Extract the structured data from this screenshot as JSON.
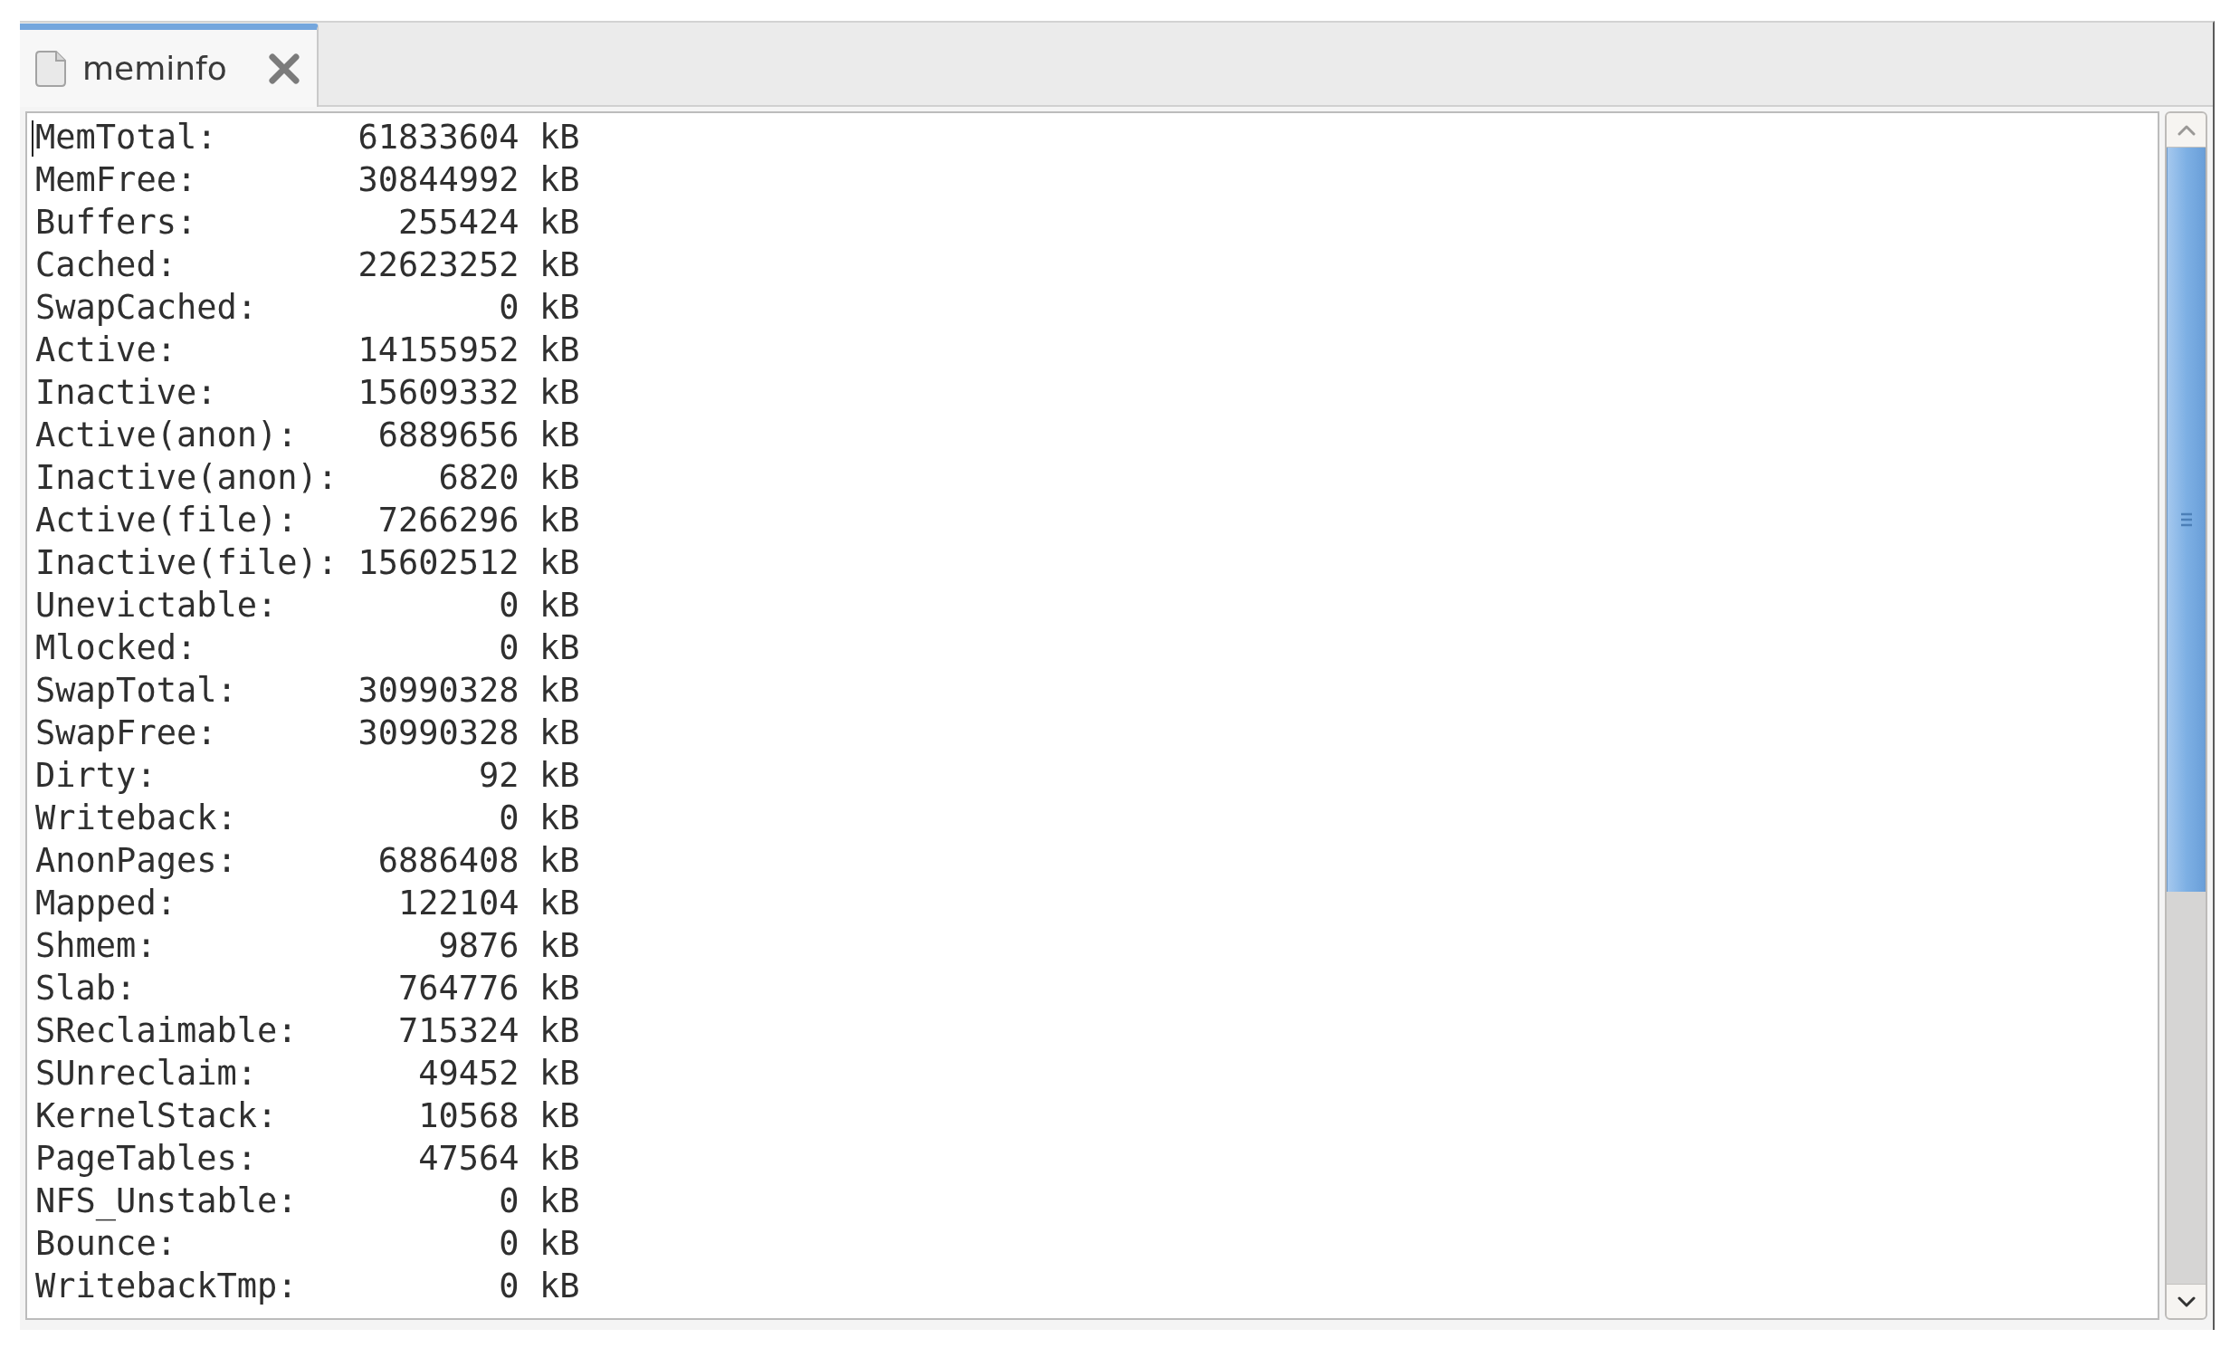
{
  "tabs": [
    {
      "label": "meminfo",
      "selected": true
    }
  ],
  "editor": {
    "cursor": true,
    "lines": [
      {
        "key": "MemTotal:",
        "value": "61833604",
        "unit": "kB"
      },
      {
        "key": "MemFree:",
        "value": "30844992",
        "unit": "kB"
      },
      {
        "key": "Buffers:",
        "value": "255424",
        "unit": "kB"
      },
      {
        "key": "Cached:",
        "value": "22623252",
        "unit": "kB"
      },
      {
        "key": "SwapCached:",
        "value": "0",
        "unit": "kB"
      },
      {
        "key": "Active:",
        "value": "14155952",
        "unit": "kB"
      },
      {
        "key": "Inactive:",
        "value": "15609332",
        "unit": "kB"
      },
      {
        "key": "Active(anon):",
        "value": "6889656",
        "unit": "kB"
      },
      {
        "key": "Inactive(anon):",
        "value": "6820",
        "unit": "kB"
      },
      {
        "key": "Active(file):",
        "value": "7266296",
        "unit": "kB"
      },
      {
        "key": "Inactive(file):",
        "value": "15602512",
        "unit": "kB"
      },
      {
        "key": "Unevictable:",
        "value": "0",
        "unit": "kB"
      },
      {
        "key": "Mlocked:",
        "value": "0",
        "unit": "kB"
      },
      {
        "key": "SwapTotal:",
        "value": "30990328",
        "unit": "kB"
      },
      {
        "key": "SwapFree:",
        "value": "30990328",
        "unit": "kB"
      },
      {
        "key": "Dirty:",
        "value": "92",
        "unit": "kB"
      },
      {
        "key": "Writeback:",
        "value": "0",
        "unit": "kB"
      },
      {
        "key": "AnonPages:",
        "value": "6886408",
        "unit": "kB"
      },
      {
        "key": "Mapped:",
        "value": "122104",
        "unit": "kB"
      },
      {
        "key": "Shmem:",
        "value": "9876",
        "unit": "kB"
      },
      {
        "key": "Slab:",
        "value": "764776",
        "unit": "kB"
      },
      {
        "key": "SReclaimable:",
        "value": "715324",
        "unit": "kB"
      },
      {
        "key": "SUnreclaim:",
        "value": "49452",
        "unit": "kB"
      },
      {
        "key": "KernelStack:",
        "value": "10568",
        "unit": "kB"
      },
      {
        "key": "PageTables:",
        "value": "47564",
        "unit": "kB"
      },
      {
        "key": "NFS_Unstable:",
        "value": "0",
        "unit": "kB"
      },
      {
        "key": "Bounce:",
        "value": "0",
        "unit": "kB"
      },
      {
        "key": "WritebackTmp:",
        "value": "0",
        "unit": "kB"
      }
    ]
  }
}
